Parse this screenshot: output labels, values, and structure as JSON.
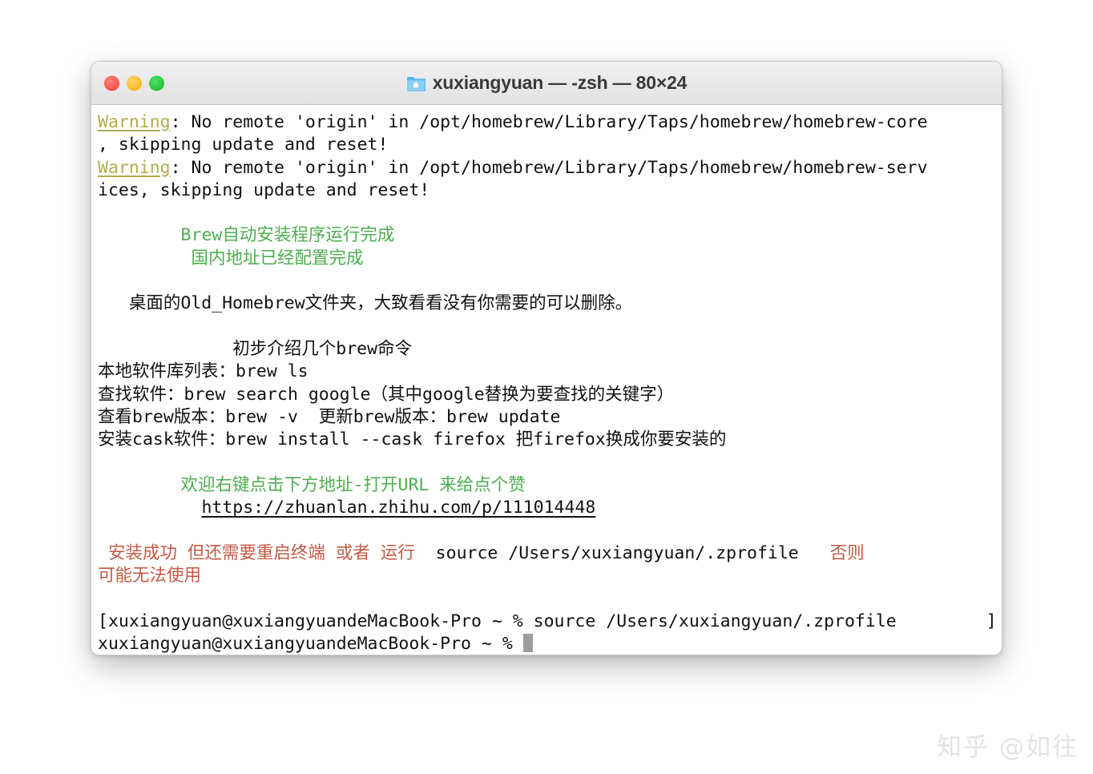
{
  "window": {
    "title": "xuxiangyuan — -zsh — 80×24",
    "icon": "home-folder-icon",
    "traffic_lights": {
      "close_label": "close",
      "minimize_label": "minimize",
      "maximize_label": "maximize",
      "close_color": "#f9574f",
      "minimize_color": "#fbbd2e",
      "maximize_color": "#29c63e"
    }
  },
  "colors": {
    "warning": "#b3ae4d",
    "green": "#4cae4f",
    "red": "#c35a45",
    "text": "#111111",
    "cursor": "#9d9d9d",
    "watermark": "#e3e3e3"
  },
  "terminal": {
    "lines": {
      "l1_warn": "Warning",
      "l1_rest": ": No remote 'origin' in /opt/homebrew/Library/Taps/homebrew/homebrew-core",
      "l2": ", skipping update and reset!",
      "l3_warn": "Warning",
      "l3_rest": ": No remote 'origin' in /opt/homebrew/Library/Taps/homebrew/homebrew-serv",
      "l4": "ices, skipping update and reset!",
      "l5_green": "        Brew自动安装程序运行完成",
      "l6_green": "         国内地址已经配置完成",
      "l7": "   桌面的Old_Homebrew文件夹，大致看看没有你需要的可以删除。",
      "l8": "             初步介绍几个brew命令",
      "l9": "本地软件库列表：brew ls",
      "l10": "查找软件：brew search google（其中google替换为要查找的关键字）",
      "l11": "查看brew版本：brew -v  更新brew版本：brew update",
      "l12": "安装cask软件：brew install --cask firefox 把firefox换成你要安装的",
      "l13_green": "        欢迎右键点击下方地址-打开URL 来给点个赞",
      "l14_url": "https://zhuanlan.zhihu.com/p/111014448",
      "l14_indent": "          ",
      "l15_red_a": " 安装成功 但还需要重启终端 或者 运行 ",
      "l15_black": " source /Users/xuxiangyuan/.zprofile  ",
      "l15_red_b": " 否则",
      "l16_red": "可能无法使用",
      "l17_bracket_open": "[",
      "l17_prompt": "xuxiangyuan@xuxiangyuandeMacBook-Pro ~ % source /Users/xuxiangyuan/.zprofile",
      "l17_bracket_close": "]",
      "l18_prompt": "xuxiangyuan@xuxiangyuandeMacBook-Pro ~ % "
    }
  },
  "watermark": {
    "text": "知乎 @如往"
  }
}
